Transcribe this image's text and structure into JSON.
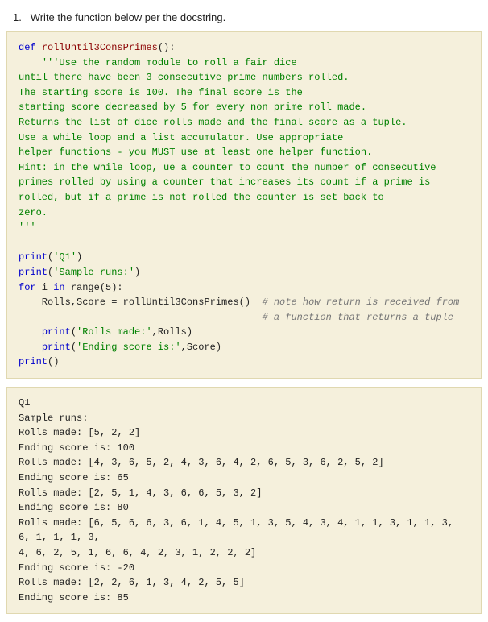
{
  "question": {
    "number": "1.",
    "text": "Write the function below per the docstring."
  },
  "code": {
    "lines": "def rollUntil3ConsPrimes():\n    '''Use the random module to roll a fair dice\nuntil there have been 3 consecutive prime numbers rolled.\nThe starting score is 100. The final score is the\nstarting score decreased by 5 for every non prime roll made.\nReturns the list of dice rolls made and the final score as a tuple.\nUse a while loop and a list accumulator. Use appropriate\nhelper functions - you MUST use at least one helper function.\nHint: in the while loop, ue a counter to count the number of consecutive\nprimes rolled by using a counter that increases its count if a prime is\nrolled, but if a prime is not rolled the counter is set back to\nzero.\n'''\n\nprint('Q1')\nprint('Sample runs:')\nfor i in range(5):\n    Rolls,Score = rollUntil3ConsPrimes()  # note how return is received from\n                                          # a function that returns a tuple\n    print('Rolls made:',Rolls)\n    print('Ending score is:',Score)\nprint()"
  },
  "output": {
    "text": "Q1\nSample runs:\nRolls made: [5, 2, 2]\nEnding score is: 100\nRolls made: [4, 3, 6, 5, 2, 4, 3, 6, 4, 2, 6, 5, 3, 6, 2, 5, 2]\nEnding score is: 65\nRolls made: [2, 5, 1, 4, 3, 6, 6, 5, 3, 2]\nEnding score is: 80\nRolls made: [6, 5, 6, 6, 3, 6, 1, 4, 5, 1, 3, 5, 4, 3, 4, 1, 1, 3, 1, 1, 3, 6, 1, 1, 1, 3,\n4, 6, 2, 5, 1, 6, 6, 4, 2, 3, 1, 2, 2, 2]\nEnding score is: -20\nRolls made: [2, 2, 6, 1, 3, 4, 2, 5, 5]\nEnding score is: 85"
  }
}
